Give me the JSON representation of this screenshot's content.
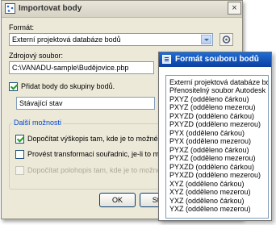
{
  "dialog": {
    "title": "Importovat body",
    "close_glyph": "×",
    "format_label": "Formát:",
    "format_value": "Externí projektová databáze bodů",
    "source_label": "Zdrojový soubor:",
    "source_value": "C:\\VANADU-sample\\Budějovice.pbp",
    "add_to_group_label": "Přidat body do skupiny bodů.",
    "group_value": "Stávající stav",
    "more_options_title": "Další možnosti",
    "opt_elevation_label": "Dopočítat výškopis tam, kde je to možné",
    "opt_transform_label": "Provést transformaci souřadnic, je-li to možné",
    "opt_planimetry_label": "Dopočítat polohopis tam, kde je to možné",
    "ok_label": "OK",
    "cancel_label_partial": "St"
  },
  "popup": {
    "title": "Formát souboru bodů",
    "items": [
      "Externí projektová databáze bodů",
      "Přenositelný soubor Autodesk",
      "PXYZ (odděleno čárkou)",
      "PXYZ (odděleno mezerou)",
      "PXYZD (odděleno čárkou)",
      "PXYZD (odděleno mezerou)",
      "PYX (odděleno čárkou)",
      "PYX (odděleno mezerou)",
      "PYXZ (odděleno čárkou)",
      "PYXZ (odděleno mezerou)",
      "PYXZD (odděleno čárkou)",
      "PYXZD (odděleno mezerou)",
      "XYZ (odděleno čárkou)",
      "XYZ (odděleno mezerou)",
      "YXZ (odděleno čárkou)",
      "YXZ (odděleno mezerou)"
    ]
  },
  "icons": {
    "app": "import-points-icon",
    "browse": "folder-browse-icon",
    "pick": "pick-from-drawing-icon",
    "popup_app": "list-window-icon"
  },
  "colors": {
    "dialog_bg": "#ece9d8",
    "popup_title": "#0b3f9f",
    "group_title": "#0046d5"
  }
}
